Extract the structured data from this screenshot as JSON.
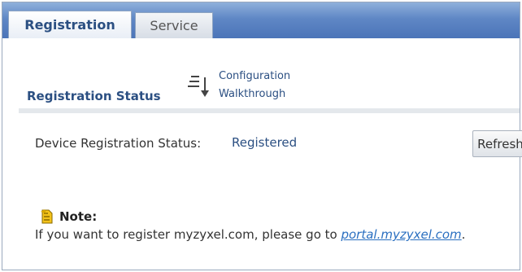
{
  "tabs": [
    {
      "label": "Registration",
      "active": true
    },
    {
      "label": "Service",
      "active": false
    }
  ],
  "section": {
    "title": "Registration Status",
    "walkthrough_line1": "Configuration",
    "walkthrough_line2": "Walkthrough"
  },
  "device": {
    "label": "Device Registration Status:",
    "value": "Registered",
    "refresh_label": "Refresh"
  },
  "note": {
    "label": "Note:",
    "text_before": "If you want to register myzyxel.com, please go to ",
    "link_text": "portal.myzyxel.com",
    "text_after": "."
  },
  "colors": {
    "accent": "#2b4f82",
    "link": "#2a6fc0",
    "tabbar": "#5f87c5"
  },
  "icons": {
    "walkthrough": "walkthrough-icon",
    "note": "note-icon"
  }
}
